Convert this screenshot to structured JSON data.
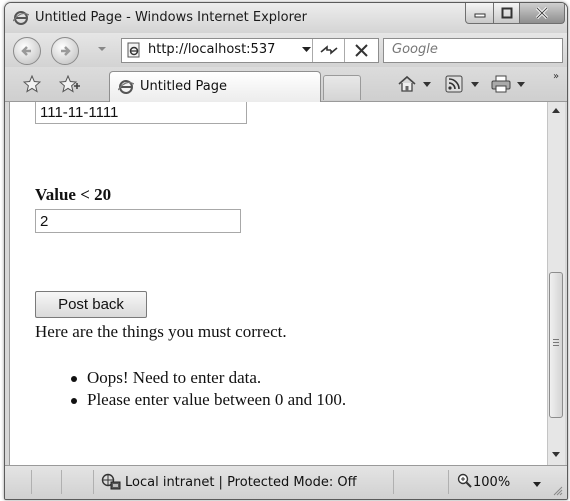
{
  "window": {
    "title": "Untitled Page - Windows Internet Explorer",
    "icon": "ie-icon"
  },
  "navigation": {
    "address_url": "http://localhost:537",
    "search_placeholder": "Google",
    "icons": [
      "back-arrow-icon",
      "forward-arrow-icon",
      "page-icon",
      "refresh-icon",
      "stop-icon"
    ]
  },
  "tabs": {
    "active_tab_title": "Untitled Page",
    "command_icons": [
      "home-icon",
      "feeds-icon",
      "print-icon"
    ]
  },
  "form": {
    "ssn_value": "111-11-1111",
    "value_label": "Value < 20",
    "value_input": "2",
    "postback_label": "Post back"
  },
  "validation": {
    "header": "Here are the things you must correct.",
    "errors": [
      "Oops! Need to enter data.",
      "Please enter value between 0 and 100."
    ]
  },
  "status": {
    "zone": "Local intranet | Protected Mode: Off",
    "zoom": "100%"
  },
  "colors": {
    "chrome": "#d7d7d7",
    "page": "#ffffff",
    "text": "#111111"
  }
}
